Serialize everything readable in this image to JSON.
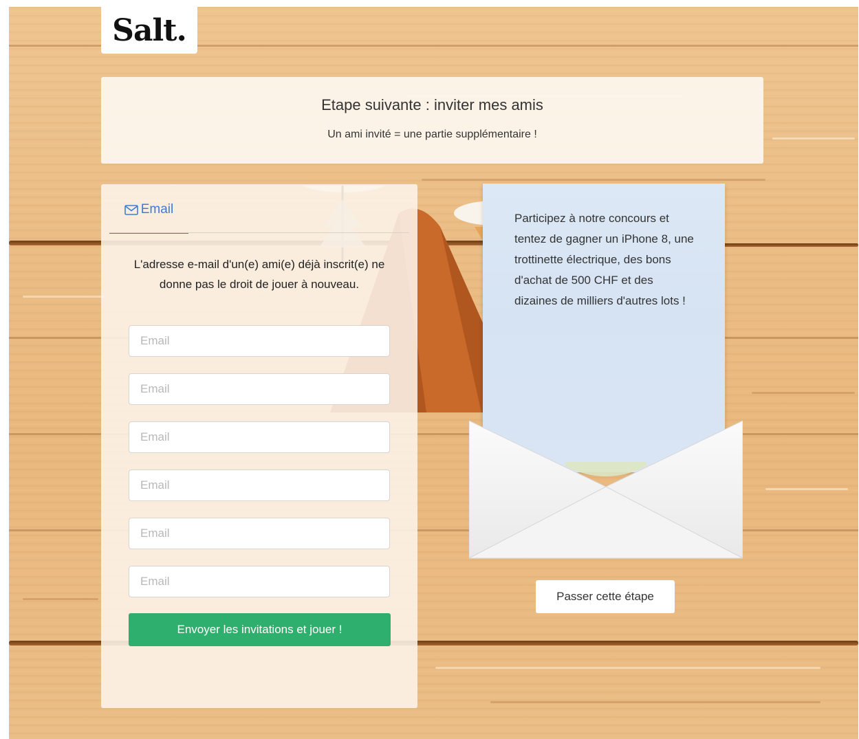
{
  "brand": {
    "logo_text": "Salt."
  },
  "header": {
    "title": "Etape suivante : inviter mes amis",
    "subtitle": "Un ami invité = une partie supplémentaire !"
  },
  "form": {
    "tab_label": "Email",
    "tab_icon": "envelope-icon",
    "notice": "L'adresse e-mail d'un(e) ami(e) déjà inscrit(e) ne donne pas le droit de jouer à nouveau.",
    "inputs": [
      {
        "placeholder": "Email",
        "value": ""
      },
      {
        "placeholder": "Email",
        "value": ""
      },
      {
        "placeholder": "Email",
        "value": ""
      },
      {
        "placeholder": "Email",
        "value": ""
      },
      {
        "placeholder": "Email",
        "value": ""
      },
      {
        "placeholder": "Email",
        "value": ""
      }
    ],
    "submit_label": "Envoyer les invitations et jouer !"
  },
  "letter": {
    "text": "Participez à notre concours et tentez de gagner un iPhone 8, une trottinette électrique, des bons d'achat de 500 CHF et des dizaines de milliers d'autres lots !"
  },
  "skip_label": "Passer cette étape",
  "colors": {
    "accent_blue": "#3d7bd9",
    "button_green": "#2faf6e",
    "wood": "#ebbd85"
  }
}
